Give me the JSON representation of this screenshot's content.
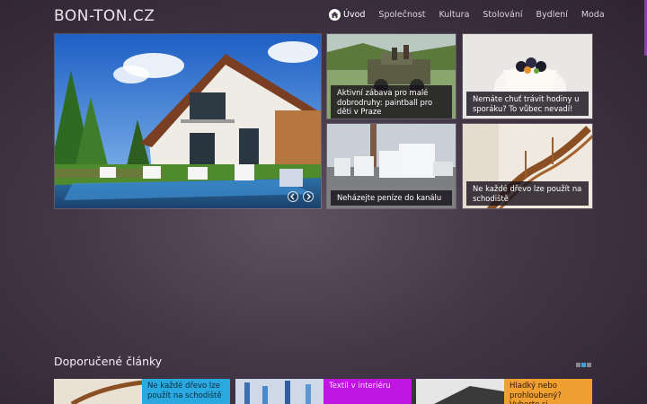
{
  "header": {
    "logo": "BON-TON.CZ",
    "nav": [
      {
        "label": "Úvod",
        "active": true
      },
      {
        "label": "Společnost"
      },
      {
        "label": "Kultura"
      },
      {
        "label": "Stolování"
      },
      {
        "label": "Bydlení"
      },
      {
        "label": "Moda"
      }
    ]
  },
  "slider": {
    "prev_icon": "chevron-left-icon",
    "next_icon": "chevron-right-icon"
  },
  "tiles": [
    {
      "caption": "Aktivní zábava pro malé dobrodruhy: paintball pro děti v Praze"
    },
    {
      "caption": "Nemáte chuť trávit hodiny u sporáku? To vůbec nevadí!"
    },
    {
      "caption": "Neházejte peníze do kanálu"
    },
    {
      "caption": "Ne každé dřevo lze použít na schodiště"
    }
  ],
  "recommended": {
    "title": "Doporučené články",
    "cards": [
      {
        "text": "Ne každé dřevo lze použít na schodiště",
        "color": "#2aa8e0"
      },
      {
        "text": "Textil v interiéru",
        "color": "#c014e0"
      },
      {
        "text": "Hladký nebo prohloubený? Vyberte si...",
        "color": "#f0a030"
      }
    ]
  },
  "colors": {
    "accent": "#8b3fa0",
    "dot_active": "#3fa0d8"
  }
}
